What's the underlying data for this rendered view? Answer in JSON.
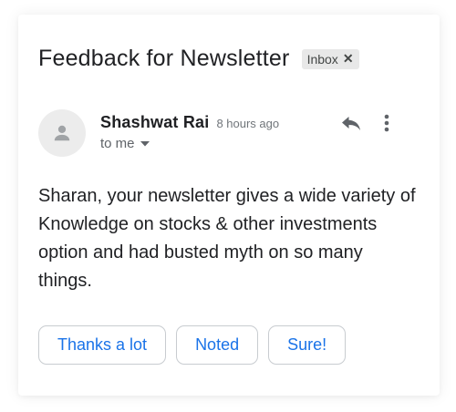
{
  "email": {
    "subject": "Feedback for Newsletter",
    "label": "Inbox",
    "label_remove": "✕",
    "sender_name": "Shashwat Rai",
    "time_ago": "8 hours ago",
    "recipient": "to me",
    "body": "Sharan, your newsletter gives a wide variety of Knowledge on stocks & other investments option and had busted myth on so many things."
  },
  "smart_replies": [
    "Thanks a lot",
    "Noted",
    "Sure!"
  ],
  "icons": {
    "avatar": "person-icon",
    "reply": "reply-icon",
    "more": "more-vertical-icon",
    "caret": "caret-down-icon"
  },
  "colors": {
    "reply_text": "#1a73e8",
    "label_chip_bg": "#e8e8e8",
    "muted_text": "#70757a"
  }
}
